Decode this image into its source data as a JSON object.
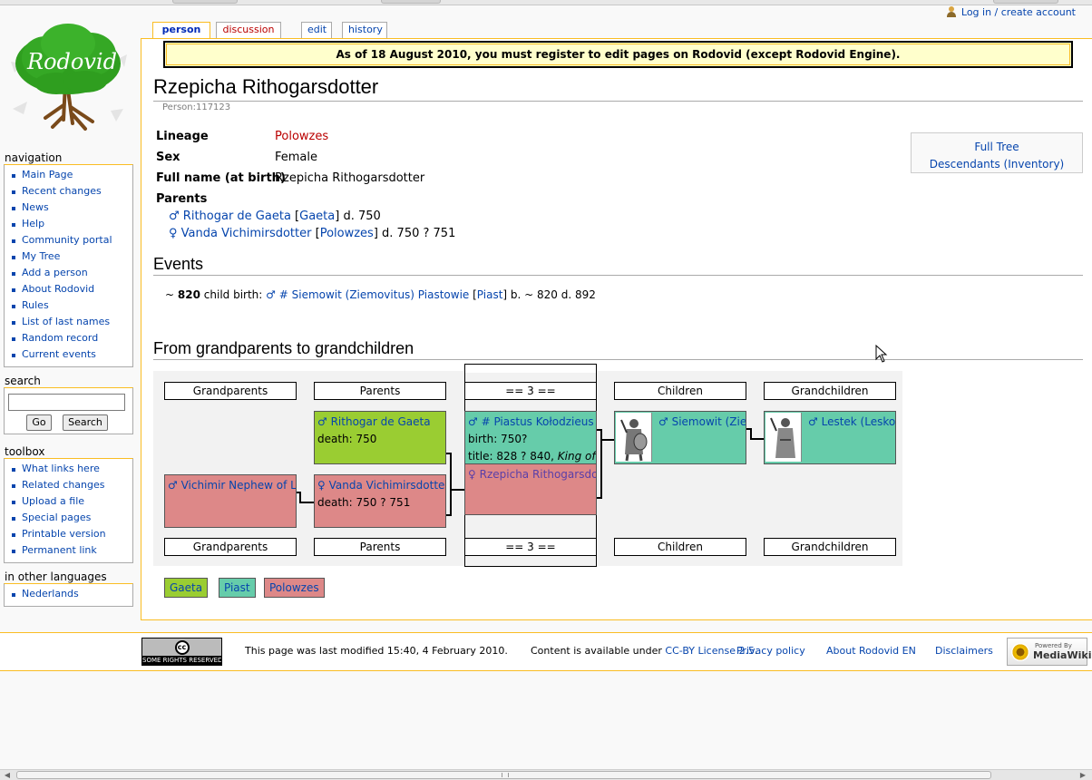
{
  "personal_tools": {
    "login": "Log in / create account"
  },
  "logo": {
    "text": "Rodovid"
  },
  "tabs": {
    "person": "person",
    "discussion": "discussion",
    "edit": "edit",
    "history": "history"
  },
  "sitenotice": "As of 18 August 2010, you must register to edit pages on Rodovid (except Rodovid Engine).",
  "page": {
    "title": "Rzepicha Rithogarsdotter",
    "subtitle": "Person:117123",
    "info": {
      "lineage_label": "Lineage",
      "lineage_value": "Polowzes",
      "sex_label": "Sex",
      "sex_value": "Female",
      "fullname_label": "Full name (at birth)",
      "fullname_value": "Rzepicha Rithogarsdotter",
      "parents_label": "Parents"
    },
    "parents": [
      {
        "symbol": "♂",
        "name": "Rithogar de Gaeta",
        "lineage": "Gaeta",
        "dates": "d. 750"
      },
      {
        "symbol": "♀",
        "name": "Vanda Vichimirsdotter",
        "lineage": "Polowzes",
        "dates": "d. 750 ? 751"
      }
    ],
    "fulltree": {
      "full_tree": "Full Tree",
      "descendants": "Descendants (Inventory)"
    },
    "events_heading": "Events",
    "event": {
      "year_prefix": "~",
      "year": "820",
      "type": "child birth:",
      "symbol": "♂",
      "person": "# Siemowit (Ziemovitus) Piastowie",
      "lineage": "Piast",
      "dates": "b. ~ 820 d. 892"
    },
    "tree_heading": "From grandparents to grandchildren"
  },
  "tree": {
    "headers": [
      "Grandparents",
      "Parents",
      "== 3 ==",
      "Children",
      "Grandchildren"
    ],
    "boxes": {
      "rithogar": {
        "symbol": "♂",
        "name": "Rithogar de Gaeta",
        "line2": "death: 750"
      },
      "vanda": {
        "symbol": "♀",
        "name": "Vanda Vichimirsdotter",
        "line2": "death: 750 ? 751"
      },
      "vichimir": {
        "symbol": "♂",
        "name": "Vichimir Nephew of Le"
      },
      "piastus": {
        "symbol": "♂",
        "name": "# Piastus Kołodzieus",
        "line2": "birth: 750?",
        "line3a": "title: 828 ? 840, ",
        "line3b": "King of"
      },
      "rzepicha": {
        "symbol": "♀",
        "name": "Rzepicha Rithogarsdo"
      },
      "siemowit": {
        "symbol": "♂",
        "name": "Siemowit (Zien"
      },
      "lestek": {
        "symbol": "♂",
        "name": "Lestek (Lesko"
      }
    }
  },
  "lineages": [
    {
      "name": "Gaeta",
      "color": "#9acd32"
    },
    {
      "name": "Piast",
      "color": "#66ccaa"
    },
    {
      "name": "Polowzes",
      "color": "#dd8888"
    }
  ],
  "sidebar": {
    "navigation_title": "navigation",
    "navigation": [
      "Main Page",
      "Recent changes",
      "News",
      "Help",
      "Community portal",
      "My Tree",
      "Add a person",
      "About Rodovid",
      "Rules",
      "List of last names",
      "Random record",
      "Current events"
    ],
    "search_title": "search",
    "search_go": "Go",
    "search_search": "Search",
    "toolbox_title": "toolbox",
    "toolbox": [
      "What links here",
      "Related changes",
      "Upload a file",
      "Special pages",
      "Printable version",
      "Permanent link"
    ],
    "languages_title": "in other languages",
    "languages": [
      "Nederlands"
    ]
  },
  "footer": {
    "cc_badge": "SOME RIGHTS RESERVED",
    "cc_mark": "cc",
    "modified": "This page was last modified 15:40, 4 February 2010.",
    "content_prefix": "Content is available under ",
    "license": "CC-BY License 2.5",
    "license_suffix": ".",
    "privacy": "Privacy policy",
    "about": "About Rodovid EN",
    "disclaimers": "Disclaimers",
    "mw_small": "Powered By",
    "mw_big": "MediaWiki"
  }
}
